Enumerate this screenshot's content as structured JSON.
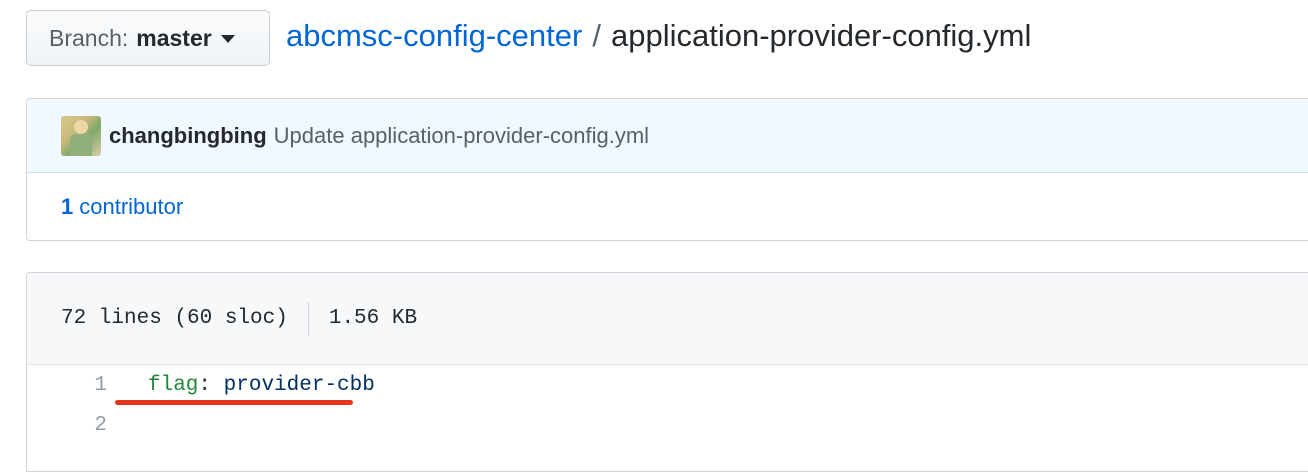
{
  "branch": {
    "prefix": "Branch:",
    "name": "master"
  },
  "breadcrumb": {
    "repo": "abcmsc-config-center",
    "separator": "/",
    "file": "application-provider-config.yml"
  },
  "commit": {
    "author": "changbingbing",
    "message": "Update application-provider-config.yml"
  },
  "contributors": {
    "count": "1",
    "label": "contributor"
  },
  "file_info": {
    "lines": "72 lines (60 sloc)",
    "size": "1.56 KB"
  },
  "code": {
    "lines": [
      {
        "num": "1",
        "key": "flag",
        "colon": ":",
        "value": "provider-cbb"
      },
      {
        "num": "2",
        "key": "",
        "colon": "",
        "value": ""
      }
    ]
  },
  "colors": {
    "link": "#0366d6",
    "annotation_underline": "#e8341c",
    "yaml_key": "#22863a",
    "yaml_value": "#032f62"
  }
}
